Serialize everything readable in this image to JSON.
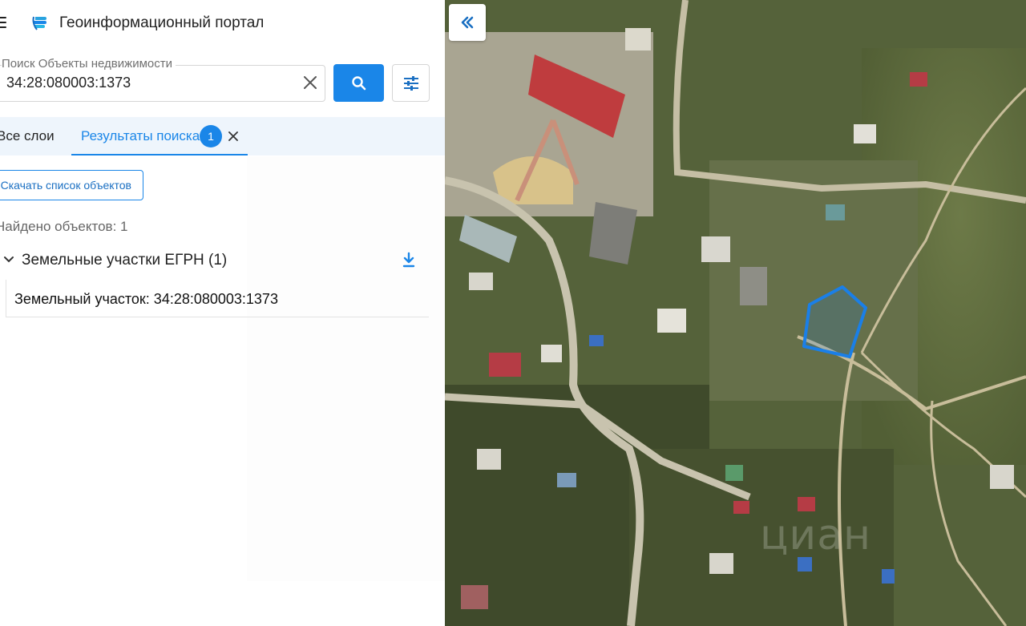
{
  "header": {
    "title": "Геоинформационный портал",
    "menu_icon": "hamburger-menu-icon",
    "logo_icon": "portal-logo-icon"
  },
  "search": {
    "legend": "Поиск Объекты недвижимости",
    "value": "34:28:080003:1373",
    "placeholder": ""
  },
  "tabs": {
    "all_layers": "Все слои",
    "results": "Результаты поиска",
    "results_count": "1"
  },
  "download_list_label": "Скачать список объектов",
  "found_text": "Найдено объектов: 1",
  "group": {
    "title": "Земельные участки ЕГРН (1)"
  },
  "results": [
    {
      "label": "Земельный участок: 34:28:080003:1373"
    }
  ],
  "map": {
    "watermark": "циан",
    "highlight_color": "#1a7fe8"
  },
  "colors": {
    "accent": "#1a86e8",
    "tab_bar_bg": "#eef5fc"
  }
}
